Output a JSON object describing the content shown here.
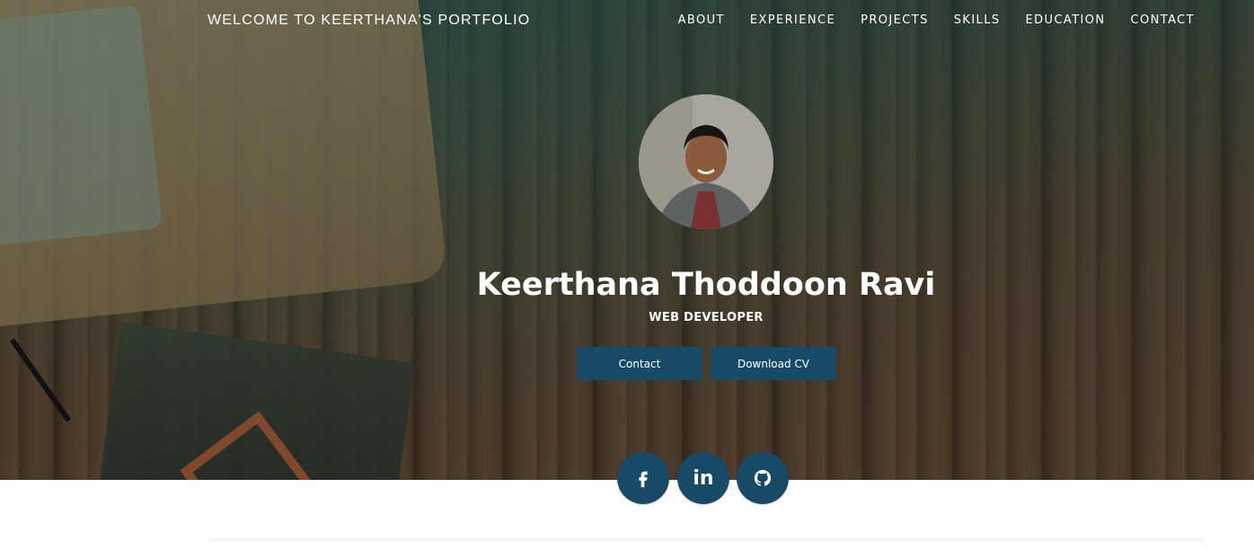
{
  "nav": {
    "brand": "WELCOME TO KEERTHANA'S PORTFOLIO",
    "links": [
      "ABOUT",
      "EXPERIENCE",
      "PROJECTS",
      "SKILLS",
      "EDUCATION",
      "CONTACT"
    ]
  },
  "profile": {
    "name": "Keerthana Thoddoon Ravi",
    "role": "WEB DEVELOPER",
    "avatar_icon": "profile-photo"
  },
  "buttons": {
    "contact": "Contact",
    "download_cv": "Download CV"
  },
  "social": {
    "facebook_icon": "facebook-icon",
    "linkedin_label": "in",
    "linkedin_icon": "linkedin-icon",
    "github_icon": "github-icon"
  },
  "colors": {
    "accent": "#174a67",
    "text_on_hero": "#ffffff",
    "page_background": "#ffffff"
  }
}
